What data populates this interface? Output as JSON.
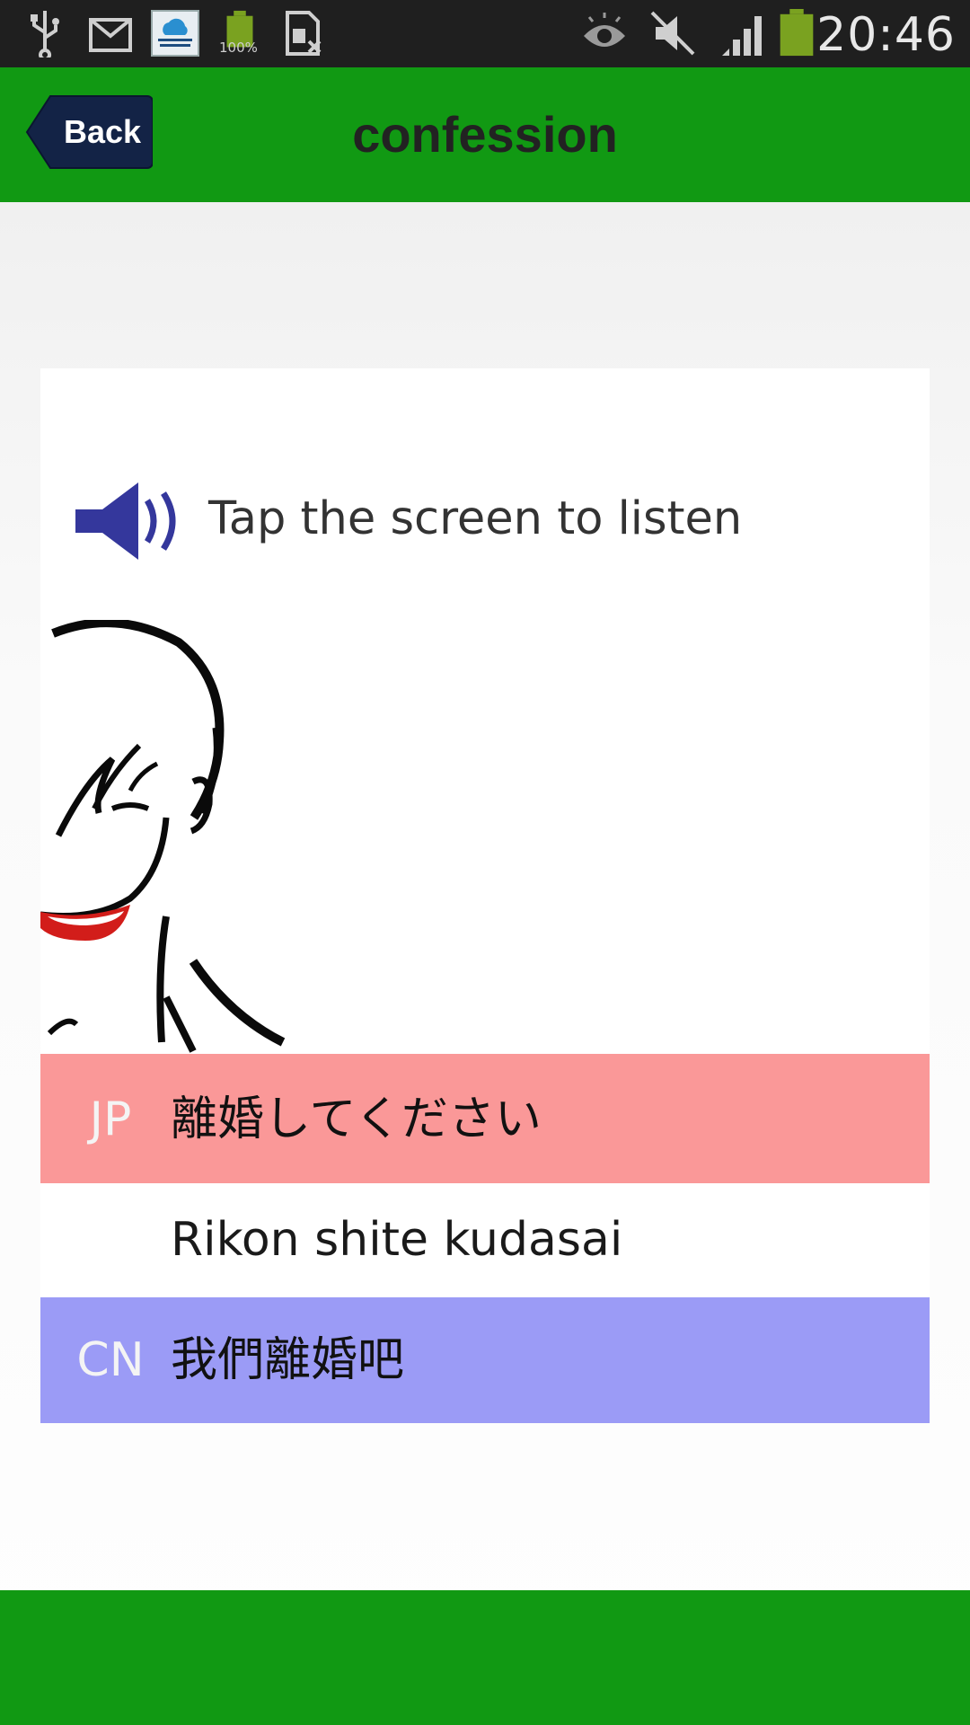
{
  "status_bar": {
    "time": "20:46",
    "battery_badge": "100%",
    "icons": [
      "usb-icon",
      "gmail-icon",
      "cloud-testing-icon",
      "battery-full-icon",
      "sim-error-icon",
      "eye-icon",
      "mute-icon",
      "signal-icon",
      "battery-icon"
    ],
    "colors": {
      "background": "#1f1f1f",
      "battery": "#7aa220"
    }
  },
  "header": {
    "back_label": "Back",
    "title": "confession",
    "colors": {
      "background": "#119913",
      "back_button": "#132346"
    }
  },
  "card": {
    "listen_text": "Tap the screen to listen",
    "icons": [
      "speaker-icon",
      "person-illustration"
    ],
    "rows": {
      "jp": {
        "tag": "JP",
        "text": "離婚してください",
        "color": "#fa9898"
      },
      "romaji": {
        "text": "Rikon shite kudasai"
      },
      "cn": {
        "tag": "CN",
        "text": "我們離婚吧",
        "color": "#9b9bf6"
      }
    }
  },
  "footer": {
    "color": "#119913"
  }
}
